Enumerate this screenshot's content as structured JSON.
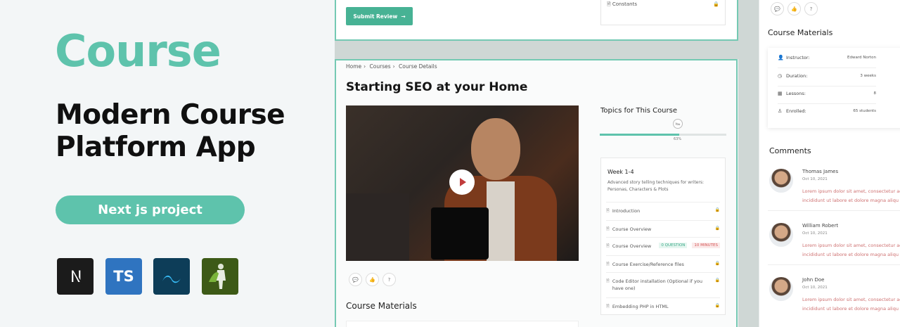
{
  "promo": {
    "title": "Course",
    "subtitle": "Modern Course Platform App",
    "pill": "Next js project",
    "tech": [
      "Next.js",
      "TS",
      "Tailwind",
      "Storybook"
    ]
  },
  "top_frame": {
    "submit_label": "Submit Review",
    "side_item": "Constants"
  },
  "main": {
    "breadcrumb": [
      "Home",
      "Courses",
      "Course Details"
    ],
    "title": "Starting SEO at your Home",
    "course_materials_title": "Course Materials",
    "topics_title": "Topics for This Course",
    "progress": {
      "badge": "You",
      "label": "63%",
      "value": 0.63
    },
    "week": "Week 1-4",
    "week_desc": "Advanced story telling techniques for writers: Personas, Characters & Plots",
    "lessons": [
      {
        "label": "Introduction"
      },
      {
        "label": "Course Overview"
      },
      {
        "label": "Course Overview",
        "tag_green": "0 QUESTION",
        "tag_red": "10 MINUTES"
      },
      {
        "label": "Course Exercise/Reference files"
      },
      {
        "label": "Code Editor installation (Optional if you have one)"
      },
      {
        "label": "Embedding PHP in HTML"
      }
    ]
  },
  "right": {
    "materials_title": "Course Materials",
    "rows": [
      {
        "key": "Instructor:",
        "value": "Edward Norton"
      },
      {
        "key": "Duration:",
        "value": "3 weeks"
      },
      {
        "key": "Lessons:",
        "value": "8"
      },
      {
        "key": "Enrolled:",
        "value": "65 students"
      }
    ],
    "comments_title": "Comments",
    "comments": [
      {
        "name": "Thomas James",
        "date": "Oct 10, 2021",
        "line1": "Lorem ipsum dolor sit amet, consectetur adi",
        "line2": "incididunt ut labore et dolore magna aliqu"
      },
      {
        "name": "William Robert",
        "date": "Oct 10, 2021",
        "line1": "Lorem ipsum dolor sit amet, consectetur adi",
        "line2": "incididunt ut labore et dolore magna aliqu"
      },
      {
        "name": "John Doe",
        "date": "Oct 10, 2021",
        "line1": "Lorem ipsum dolor sit amet, consectetur adi",
        "line2": "incididunt ut labore et dolore magna aliqu"
      }
    ]
  },
  "colors": {
    "accent": "#5ec3ac",
    "button": "#47b294",
    "frame_border": "#74c9b3"
  }
}
